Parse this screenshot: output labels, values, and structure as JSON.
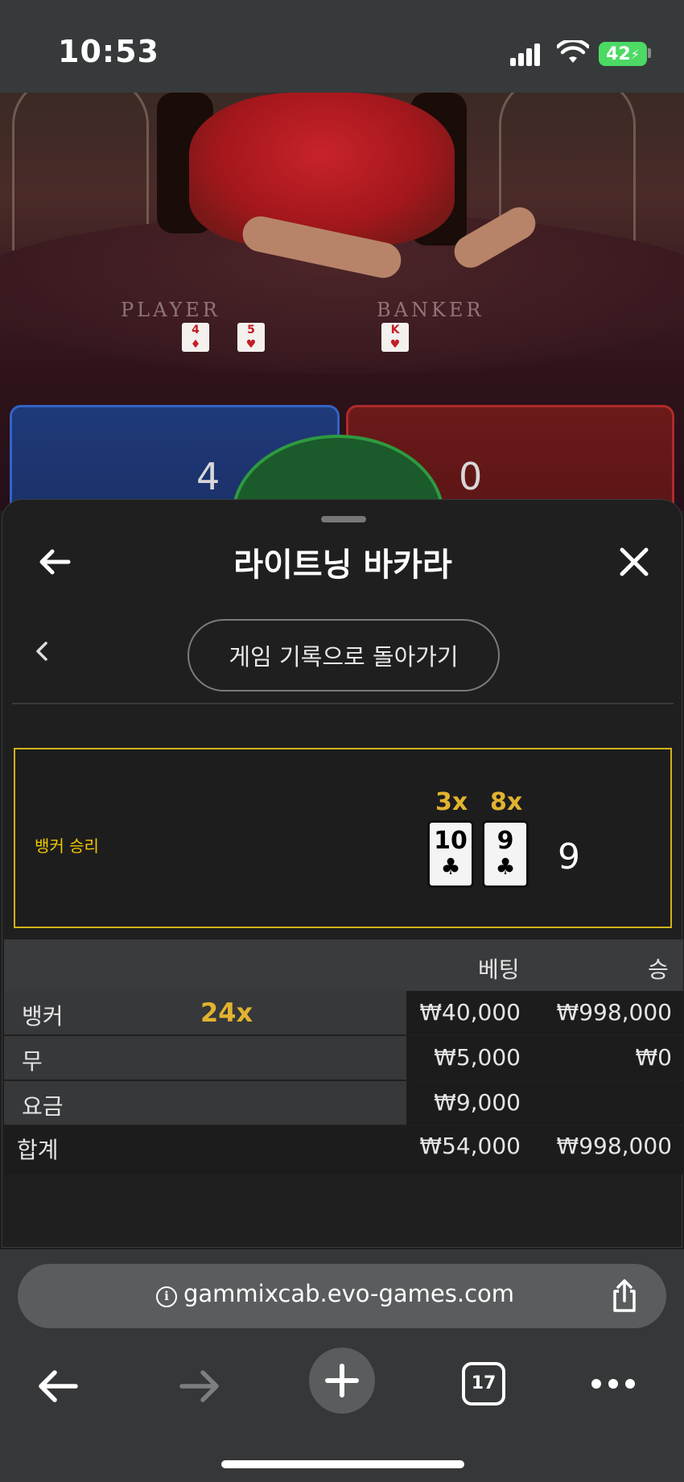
{
  "status_bar": {
    "time": "10:53",
    "battery": "42",
    "icons": [
      "signal-icon",
      "wifi-icon",
      "battery-icon"
    ]
  },
  "video": {
    "player_label": "PLAYER",
    "banker_label": "BANKER",
    "player_cards": [
      "4",
      "5"
    ],
    "banker_cards": [
      "K"
    ],
    "player_score": "4",
    "banker_score": "0"
  },
  "sheet": {
    "title": "라이트닝 바카라",
    "back_to_history": "게임 기록으로 돌아가기",
    "result": {
      "label": "뱅커 승리",
      "cards": [
        {
          "multiplier": "3x",
          "rank": "10",
          "suit": "♣"
        },
        {
          "multiplier": "8x",
          "rank": "9",
          "suit": "♣"
        }
      ],
      "total": "9"
    },
    "bets_table": {
      "headers": {
        "bet": "베팅",
        "win": "승"
      },
      "rows": [
        {
          "label": "뱅커",
          "multiplier": "24x",
          "bet": "₩40,000",
          "win": "₩998,000"
        },
        {
          "label": "무",
          "multiplier": "",
          "bet": "₩5,000",
          "win": "₩0"
        },
        {
          "label": "요금",
          "multiplier": "",
          "bet": "₩9,000",
          "win": ""
        }
      ],
      "total": {
        "label": "합계",
        "bet": "₩54,000",
        "win": "₩998,000"
      }
    }
  },
  "browser": {
    "url": "gammixcab.evo-games.com",
    "tab_count": "17"
  },
  "colors": {
    "accent_gold": "#e2b330",
    "result_border": "#d2b21a",
    "battery_green": "#4cd964"
  }
}
